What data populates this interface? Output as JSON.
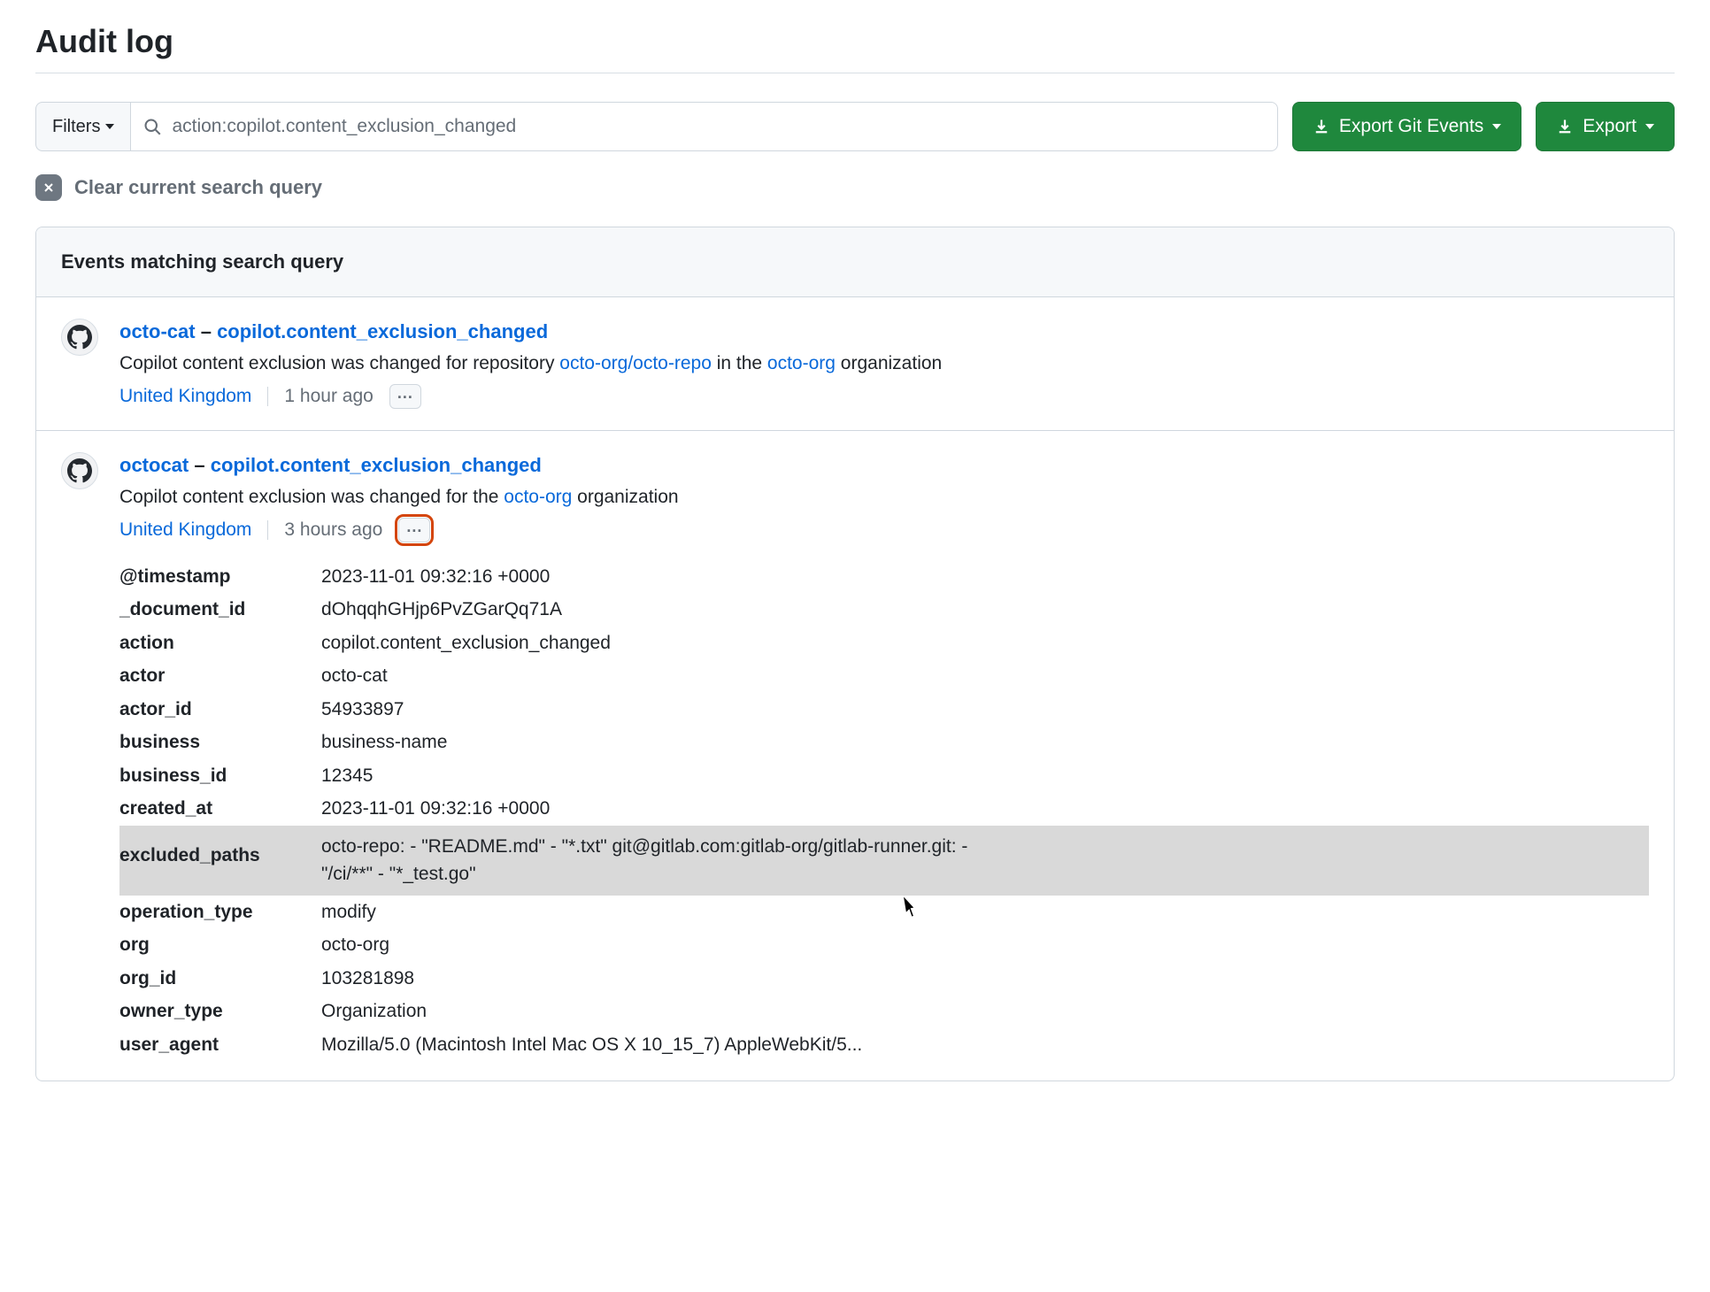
{
  "page": {
    "title": "Audit log"
  },
  "toolbar": {
    "filters_label": "Filters",
    "search_value": "action:copilot.content_exclusion_changed",
    "export_git_label": "Export Git Events",
    "export_label": "Export"
  },
  "clear": {
    "label": "Clear current search query"
  },
  "events_header": {
    "title": "Events matching search query"
  },
  "events": [
    {
      "actor": "octo-cat",
      "action": "copilot.content_exclusion_changed",
      "desc_parts": {
        "prefix": "Copilot content exclusion was changed for repository ",
        "link1": "octo-org/octo-repo",
        "mid": " in the ",
        "link2": "octo-org",
        "suffix": " organization"
      },
      "location": "United Kingdom",
      "time": "1 hour ago",
      "kebab_highlight": false,
      "expanded": false
    },
    {
      "actor": "octocat",
      "action": "copilot.content_exclusion_changed",
      "desc_parts": {
        "prefix": "Copilot content exclusion was changed for the ",
        "link1": "octo-org",
        "mid": "",
        "link2": "",
        "suffix": " organization"
      },
      "location": "United Kingdom",
      "time": "3 hours ago",
      "kebab_highlight": true,
      "expanded": true,
      "details": [
        {
          "k": "@timestamp",
          "v": "2023-11-01 09:32:16 +0000"
        },
        {
          "k": "_document_id",
          "v": "dOhqqhGHjp6PvZGarQq71A"
        },
        {
          "k": "action",
          "v": "copilot.content_exclusion_changed"
        },
        {
          "k": "actor",
          "v": "octo-cat"
        },
        {
          "k": "actor_id",
          "v": "54933897"
        },
        {
          "k": "business",
          "v": "business-name"
        },
        {
          "k": "business_id",
          "v": "12345"
        },
        {
          "k": "created_at",
          "v": "2023-11-01 09:32:16 +0000"
        },
        {
          "k": "excluded_paths",
          "v": "octo-repo: - \"README.md\" - \"*.txt\" git@gitlab.com:gitlab-org/gitlab-runner.git: - \"/ci/**\" - \"*_test.go\"",
          "highlight": true,
          "cursor": true
        },
        {
          "k": "operation_type",
          "v": "modify"
        },
        {
          "k": "org",
          "v": "octo-org"
        },
        {
          "k": "org_id",
          "v": "103281898"
        },
        {
          "k": "owner_type",
          "v": "Organization"
        },
        {
          "k": "user_agent",
          "v": "Mozilla/5.0 (Macintosh Intel Mac OS X 10_15_7) AppleWebKit/5..."
        }
      ]
    }
  ]
}
